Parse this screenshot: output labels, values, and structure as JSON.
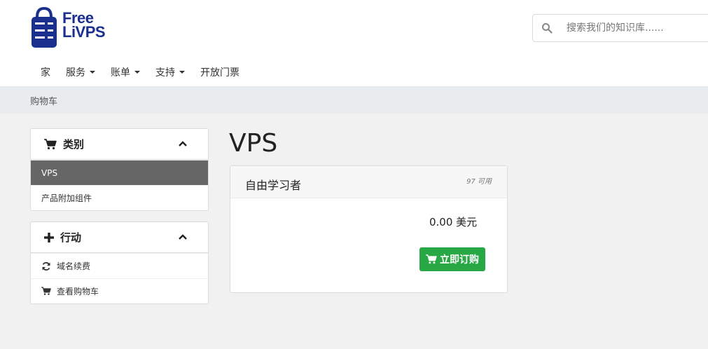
{
  "brand": {
    "line1": "Free",
    "line2": "LiVPS",
    "color": "#1b2f8f"
  },
  "search": {
    "placeholder": "搜索我们的知识库......"
  },
  "nav": [
    {
      "label": "家",
      "dropdown": false
    },
    {
      "label": "服务",
      "dropdown": true
    },
    {
      "label": "账单",
      "dropdown": true
    },
    {
      "label": "支持",
      "dropdown": true
    },
    {
      "label": "开放门票",
      "dropdown": false
    }
  ],
  "breadcrumb": "购物车",
  "categories": {
    "title": "类别",
    "items": [
      {
        "label": "VPS",
        "active": true
      },
      {
        "label": "产品附加组件",
        "active": false
      }
    ]
  },
  "actions": {
    "title": "行动",
    "items": [
      {
        "label": "域名续费",
        "icon": "refresh-icon"
      },
      {
        "label": "查看购物车",
        "icon": "cart-icon"
      }
    ]
  },
  "page_title": "VPS",
  "product": {
    "name": "自由学习者",
    "availability": "97 可用",
    "price": "0.00 美元",
    "order_label": "立即订购"
  },
  "colors": {
    "accent_green": "#28a745",
    "active_row": "#666666"
  }
}
